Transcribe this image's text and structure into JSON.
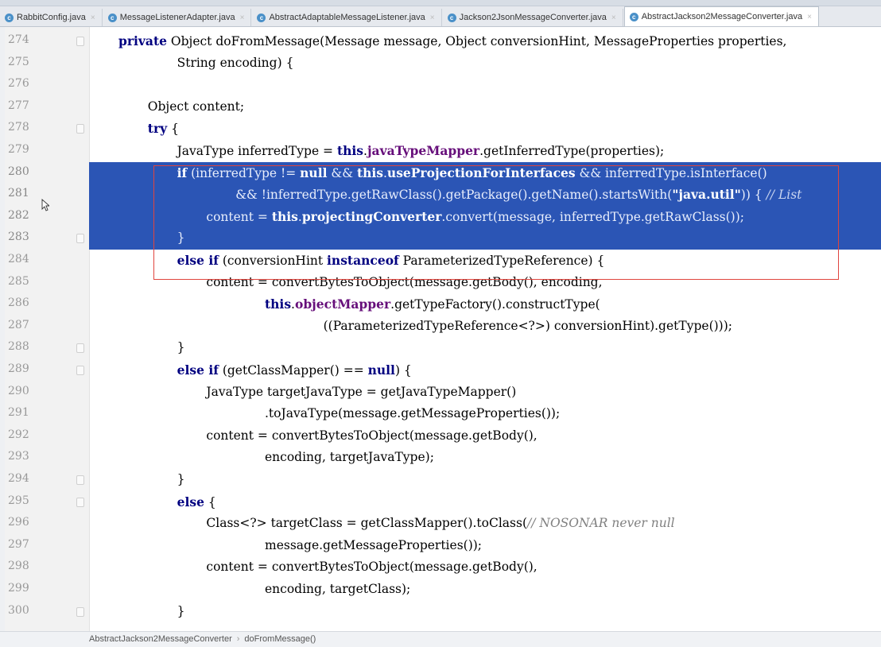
{
  "tabs": [
    {
      "label": "RabbitConfig.java",
      "active": false
    },
    {
      "label": "MessageListenerAdapter.java",
      "active": false
    },
    {
      "label": "AbstractAdaptableMessageListener.java",
      "active": false
    },
    {
      "label": "Jackson2JsonMessageConverter.java",
      "active": false
    },
    {
      "label": "AbstractJackson2MessageConverter.java",
      "active": true
    }
  ],
  "editor": {
    "lines": [
      {
        "num": "274",
        "html": "<span class=\"kw\">private</span> Object doFromMessage(Message message, Object conversionHint, MessageProperties properties,",
        "indent": 0
      },
      {
        "num": "275",
        "html": "String encoding) {",
        "indent": 2
      },
      {
        "num": "276",
        "html": "",
        "indent": 0
      },
      {
        "num": "277",
        "html": "Object content;",
        "indent": 1
      },
      {
        "num": "278",
        "html": "<span class=\"kw\">try</span> {",
        "indent": 1
      },
      {
        "num": "279",
        "html": "JavaType inferredType = <span class=\"kw\">this</span>.<span class=\"fld\">javaTypeMapper</span>.getInferredType(properties);",
        "indent": 2
      },
      {
        "num": "280",
        "html": "<span class=\"kw\">if</span> (inferredType != <span class=\"kw\">null</span> &amp;&amp; <span class=\"kw\">this</span>.<span class=\"fld\">useProjectionForInterfaces</span> &amp;&amp; inferredType.isInterface()",
        "indent": 2,
        "sel": true
      },
      {
        "num": "281",
        "html": "&amp;&amp; !inferredType.getRawClass().getPackage().getName().startsWith(<span class=\"str\">\"java.util\"</span>)) { <span class=\"cmt\">// List</span>",
        "indent": 4,
        "sel": true
      },
      {
        "num": "282",
        "html": "content = <span class=\"kw\">this</span>.<span class=\"fld\">projectingConverter</span>.convert(message, inferredType.getRawClass());",
        "indent": 3,
        "sel": true
      },
      {
        "num": "283",
        "html": "}",
        "indent": 2,
        "sel": true
      },
      {
        "num": "284",
        "html": "<span class=\"kw\">else if</span> (conversionHint <span class=\"kw\">instanceof</span> ParameterizedTypeReference) {",
        "indent": 2
      },
      {
        "num": "285",
        "html": "content = convertBytesToObject(message.getBody(), encoding,",
        "indent": 3
      },
      {
        "num": "286",
        "html": "<span class=\"kw\">this</span>.<span class=\"fld\">objectMapper</span>.getTypeFactory().constructType(",
        "indent": 5
      },
      {
        "num": "287",
        "html": "((ParameterizedTypeReference&lt;?&gt;) conversionHint).getType()));",
        "indent": 7
      },
      {
        "num": "288",
        "html": "}",
        "indent": 2
      },
      {
        "num": "289",
        "html": "<span class=\"kw\">else if</span> (getClassMapper() == <span class=\"kw\">null</span>) {",
        "indent": 2
      },
      {
        "num": "290",
        "html": "JavaType targetJavaType = getJavaTypeMapper()",
        "indent": 3
      },
      {
        "num": "291",
        "html": ".toJavaType(message.getMessageProperties());",
        "indent": 5
      },
      {
        "num": "292",
        "html": "content = convertBytesToObject(message.getBody(),",
        "indent": 3
      },
      {
        "num": "293",
        "html": "encoding, targetJavaType);",
        "indent": 5
      },
      {
        "num": "294",
        "html": "}",
        "indent": 2
      },
      {
        "num": "295",
        "html": "<span class=\"kw\">else</span> {",
        "indent": 2
      },
      {
        "num": "296",
        "html": "Class&lt;?&gt; targetClass = getClassMapper().toClass(<span class=\"cmt\">// NOSONAR never null</span>",
        "indent": 3
      },
      {
        "num": "297",
        "html": "message.getMessageProperties());",
        "indent": 5
      },
      {
        "num": "298",
        "html": "content = convertBytesToObject(message.getBody(),",
        "indent": 3
      },
      {
        "num": "299",
        "html": "encoding, targetClass);",
        "indent": 5
      },
      {
        "num": "300",
        "html": "}",
        "indent": 2
      }
    ]
  },
  "breadcrumb": {
    "class_name": "AbstractJackson2MessageConverter",
    "separator": "›",
    "method_name": "doFromMessage()"
  },
  "colors": {
    "selection": "#2b55b5",
    "highlight_box": "#e0453e",
    "keyword": "#000080",
    "field": "#660e7a"
  }
}
